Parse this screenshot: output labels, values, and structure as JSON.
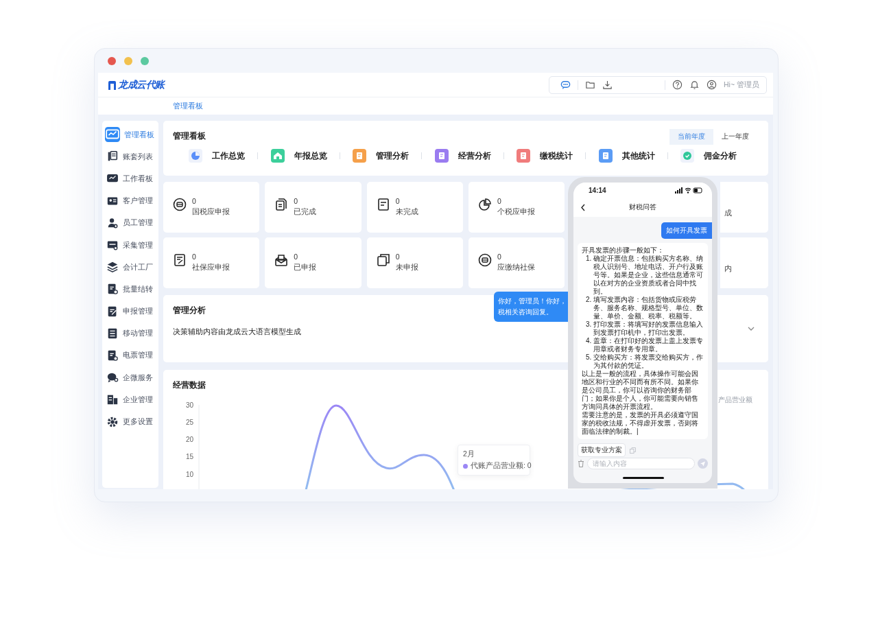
{
  "window": {
    "controls": [
      {
        "color": "#e5584f"
      },
      {
        "color": "#f2c14e"
      },
      {
        "color": "#5cc9a0"
      }
    ]
  },
  "header": {
    "logo": "龙成云代账",
    "greeting": "Hi~ 管理员"
  },
  "breadcrumb": "管理看板",
  "sidebar": {
    "items": [
      {
        "label": "管理看板",
        "selected": true
      },
      {
        "label": "账套列表",
        "selected": false
      },
      {
        "label": "工作看板",
        "selected": false
      },
      {
        "label": "客户管理",
        "selected": false
      },
      {
        "label": "员工管理",
        "selected": false
      },
      {
        "label": "采集管理",
        "selected": false
      },
      {
        "label": "会计工厂",
        "selected": false
      },
      {
        "label": "批量结转",
        "selected": false
      },
      {
        "label": "申报管理",
        "selected": false
      },
      {
        "label": "移动管理",
        "selected": false
      },
      {
        "label": "电票管理",
        "selected": false
      },
      {
        "label": "企微服务",
        "selected": false
      },
      {
        "label": "企业管理",
        "selected": false
      },
      {
        "label": "更多设置",
        "selected": false
      }
    ]
  },
  "overview": {
    "title": "管理看板",
    "periods": [
      {
        "label": "当前年度",
        "selected": true
      },
      {
        "label": "上一年度",
        "selected": false
      }
    ],
    "tabs": [
      {
        "label": "工作总览",
        "color": "#5b8ff9"
      },
      {
        "label": "年报总览",
        "color": "#3ccf9b"
      },
      {
        "label": "管理分析",
        "color": "#f5a04a"
      },
      {
        "label": "经营分析",
        "color": "#9a7cf0"
      },
      {
        "label": "缴税统计",
        "color": "#f07c7c"
      },
      {
        "label": "其他统计",
        "color": "#5b9cf5"
      },
      {
        "label": "佣金分析",
        "color": "#2fc79a"
      }
    ]
  },
  "stats": [
    {
      "kind": "full",
      "value": "0",
      "label": "国税应申报"
    },
    {
      "kind": "full",
      "value": "0",
      "label": "已完成"
    },
    {
      "kind": "full",
      "value": "0",
      "label": "未完成"
    },
    {
      "kind": "full",
      "value": "0",
      "label": "个税应申报"
    },
    {
      "kind": "hidden"
    },
    {
      "kind": "partial",
      "label": "成"
    },
    {
      "kind": "full",
      "value": "0",
      "label": "社保应申报"
    },
    {
      "kind": "full",
      "value": "0",
      "label": "已申报"
    },
    {
      "kind": "full",
      "value": "0",
      "label": "未申报"
    },
    {
      "kind": "full",
      "value": "0",
      "label": "应缴纳社保"
    },
    {
      "kind": "hidden"
    },
    {
      "kind": "partial",
      "label": "内"
    }
  ],
  "analysis": {
    "title": "管理分析",
    "text": "决策辅助内容由龙成云大语言模型生成"
  },
  "chat_bubble": {
    "lines": [
      "你好，管理员！你好，",
      "税相关咨询回复。"
    ]
  },
  "business": {
    "title": "经营数据",
    "legend": "产品营业额",
    "tooltip": {
      "title": "2月",
      "text": "代账产品营业额: 0",
      "color": "#9b87f5"
    },
    "y_axis_labels": [
      "30",
      "25",
      "20",
      "15",
      "10"
    ]
  },
  "phone": {
    "time": "14:14",
    "title": "财税问答",
    "question": "如何开具发票",
    "intro": "开具发票的步骤一般如下：",
    "steps": [
      {
        "number": "1.",
        "text": "确定开票信息：包括购买方名称、纳税人识别号、地址电话、开户行及账号等。如果是企业，这些信息通常可以在对方的企业资质或者合同中找到。"
      },
      {
        "number": "2.",
        "text": "填写发票内容：包括货物或应税劳务、服务名称、规格型号、单位、数量、单价、金额、税率、税额等。"
      },
      {
        "number": "3.",
        "text": "打印发票：将填写好的发票信息输入到发票打印机中，打印出发票。"
      },
      {
        "number": "4.",
        "text": "盖章：在打印好的发票上盖上发票专用章或者财务专用章。"
      },
      {
        "number": "5.",
        "text": "交给购买方：将发票交给购买方，作为其付款的凭证。"
      }
    ],
    "outro": [
      "以上是一般的流程，具体操作可能会因地区和行业的不同而有所不同。如果你是公司员工，你可以咨询你的财务部门；如果你是个人，你可能需要向销售方询问具体的开票流程。",
      "需要注意的是，发票的开具必须遵守国家的税收法规，不得虚开发票，否则将面临法律的制裁。|"
    ],
    "action": "获取专业方案",
    "placeholder": "请输入内容"
  }
}
